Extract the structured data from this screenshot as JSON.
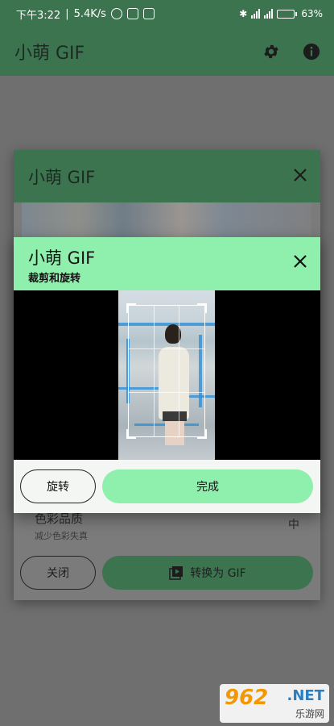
{
  "status_bar": {
    "time": "下午3:22",
    "speed": "5.4K/s",
    "battery": "63",
    "battery_unit": "%",
    "battery_level": 0.63
  },
  "app_bar": {
    "title": "小萌 GIF",
    "settings_icon": "gear-icon",
    "info_icon": "info-icon"
  },
  "background_dialog": {
    "title": "小萌 GIF",
    "close_icon": "close-icon",
    "setting": {
      "label": "色彩品质",
      "description": "减少色彩失真",
      "value": "中"
    },
    "close_label": "关闭",
    "convert_label": "转换为 GIF"
  },
  "crop_dialog": {
    "title": "小萌 GIF",
    "subtitle": "裁剪和旋转",
    "close_icon": "close-icon",
    "rotate_label": "旋转",
    "done_label": "完成"
  },
  "watermark": {
    "number": "962",
    "domain": ".NET",
    "site": "乐游网"
  },
  "colors": {
    "accent_dark": "#3d7450",
    "accent_light": "#8ff0ad"
  }
}
